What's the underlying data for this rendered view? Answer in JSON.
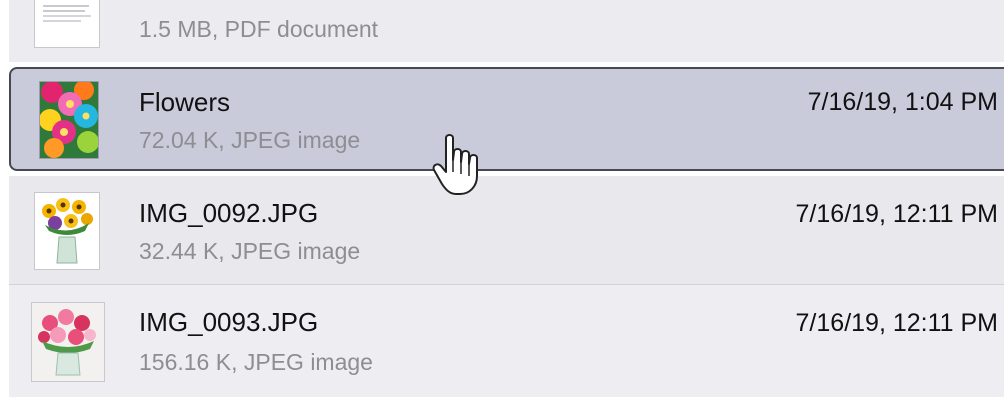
{
  "files": [
    {
      "meta": "1.5 MB, PDF document"
    },
    {
      "name": "Flowers",
      "meta": "72.04 K, JPEG image",
      "date": "7/16/19, 1:04 PM",
      "selected": true
    },
    {
      "name": "IMG_0092.JPG",
      "meta": "32.44 K, JPEG image",
      "date": "7/16/19, 12:11 PM"
    },
    {
      "name": "IMG_0093.JPG",
      "meta": "156.16 K, JPEG image",
      "date": "7/16/19, 12:11 PM"
    }
  ],
  "icons": {
    "pdf": "pdf-document-thumbnail",
    "flowers": "flowers-image-thumbnail",
    "img92": "sunflower-vase-thumbnail",
    "img93": "rose-bouquet-thumbnail",
    "cursor": "hand-pointer-icon"
  },
  "colors": {
    "selected_row": "#c9cbdb",
    "row": "#ececf0",
    "meta_text": "#8d8d92"
  }
}
